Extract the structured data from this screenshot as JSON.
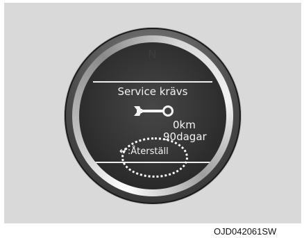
{
  "dial": {
    "compass_letter": "N",
    "title": "Service krävs",
    "wrench_icon": "wrench-icon",
    "distance": "0km",
    "days": "90dagar",
    "reset_arrow": "↵",
    "reset_label": ":Återställ"
  },
  "caption": "OJD042061SW",
  "colors": {
    "background": "#d9d9d9",
    "dial": "#2f2f2f",
    "text": "#f4f4f4",
    "highlight_ring": "#ffffff"
  }
}
